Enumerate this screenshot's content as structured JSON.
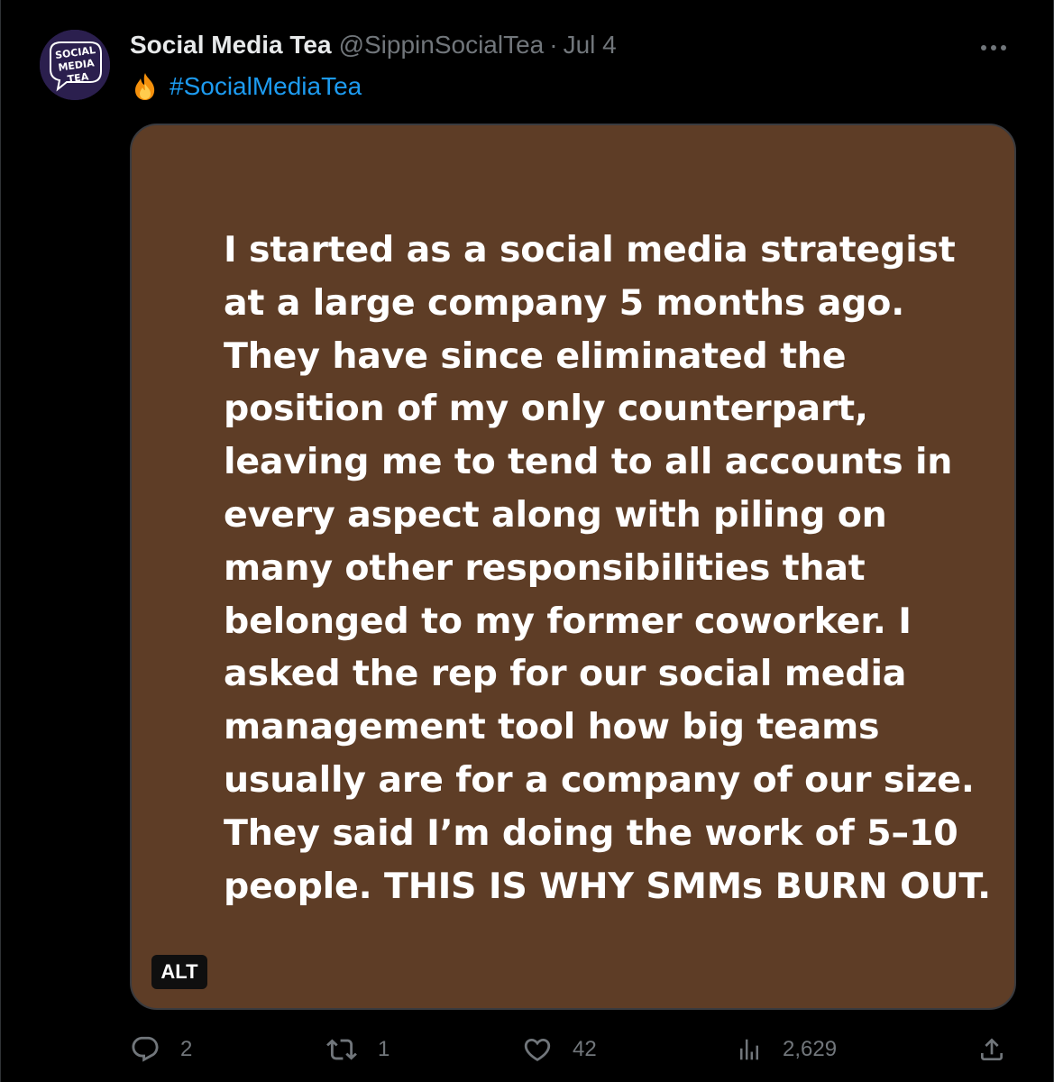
{
  "tweet": {
    "display_name": "Social Media Tea",
    "handle": "@SippinSocialTea",
    "separator": "·",
    "date": "Jul 4",
    "hashtag": "#SocialMediaTea",
    "avatar_text": [
      "SOCIAL",
      "MEDIA",
      "TEA"
    ],
    "icons": {
      "more": "more-horizontal-icon",
      "fire": "fire-emoji-icon",
      "reply": "reply-icon",
      "repost": "repost-icon",
      "like": "heart-icon",
      "views": "views-icon",
      "share": "share-icon"
    }
  },
  "media": {
    "background_color": "#5e3d26",
    "lines": [
      "I started as a social media strategist",
      "at a large company 5 months ago.",
      "They have since eliminated the",
      "position of my only counterpart,",
      "leaving me to tend to all accounts in",
      "every aspect along with piling on",
      "many other responsibilities that",
      "belonged to my former coworker. I",
      "asked the rep for our social media",
      "management tool how big teams",
      "usually are for a company of our size.",
      "They said I’m doing the work of 5–10",
      "people. THIS IS WHY SMMs BURN OUT."
    ],
    "alt_label": "ALT"
  },
  "actions": {
    "replies": "2",
    "reposts": "1",
    "likes": "42",
    "views": "2,629"
  },
  "colors": {
    "background": "#000000",
    "text_primary": "#e7e9ea",
    "text_secondary": "#71767b",
    "link": "#1d9bf0"
  }
}
